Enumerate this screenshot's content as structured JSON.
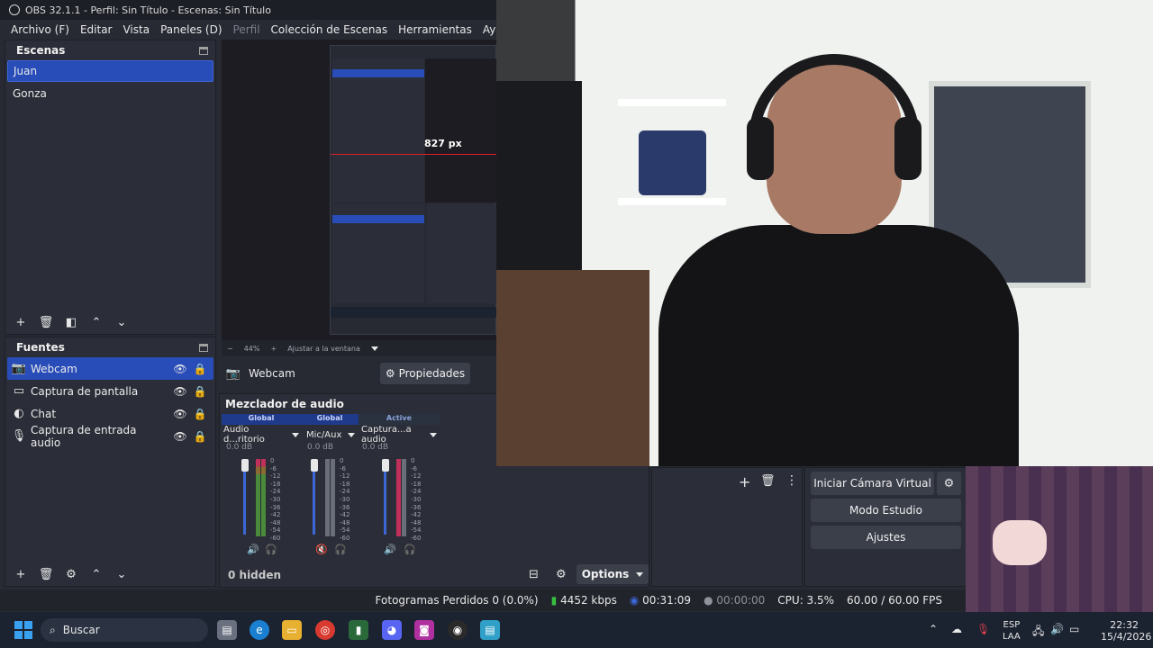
{
  "window": {
    "title": "OBS 32.1.1 - Perfil: Sin Título - Escenas: Sin Título"
  },
  "menu": [
    "Archivo (F)",
    "Editar",
    "Vista",
    "Paneles (D)",
    "Perfil",
    "Colección de Escenas",
    "Herramientas",
    "Ayuda (H)"
  ],
  "scenes": {
    "title": "Escenas",
    "items": [
      "Juan",
      "Gonza"
    ]
  },
  "sources": {
    "title": "Fuentes",
    "items": [
      "Webcam",
      "Captura de pantalla",
      "Chat",
      "Captura de entrada audio"
    ]
  },
  "preview": {
    "zoom": "44%",
    "fit": "Ajustar a la ventana",
    "measure": "827 px"
  },
  "source_bar": {
    "name": "Webcam",
    "properties": "Propiedades"
  },
  "mixer": {
    "title": "Mezclador de audio",
    "channels": [
      {
        "head": "Global",
        "name": "Audio d...ritorio",
        "db": "0.0 dB",
        "muted": false
      },
      {
        "head": "Global",
        "name": "Mic/Aux",
        "db": "0.0 dB",
        "muted": true
      },
      {
        "head": "Active",
        "name": "Captura...a audio",
        "db": "0.0 dB",
        "muted": false
      }
    ],
    "scale": [
      "0",
      "-6",
      "-12",
      "-18",
      "-24",
      "-30",
      "-36",
      "-42",
      "-48",
      "-54",
      "-60"
    ],
    "hidden": "0 hidden",
    "options": "Options"
  },
  "controls": {
    "virtual_cam": "Iniciar Cámara Virtual",
    "studio": "Modo Estudio",
    "settings": "Ajustes"
  },
  "status": {
    "dropped": "Fotogramas Perdidos 0 (0.0%)",
    "kbps": "4452 kbps",
    "rec_time": "00:31:09",
    "stream_time": "00:00:00",
    "cpu": "CPU: 3.5%",
    "fps": "60.00 / 60.00 FPS"
  },
  "taskbar": {
    "search": "Buscar",
    "lang": "ESP",
    "region": "LAA",
    "time": "22:32",
    "date": "15/4/2026"
  },
  "colors": {
    "accent": "#284cb8",
    "panel": "#2b2e38",
    "bg": "#272a33"
  }
}
